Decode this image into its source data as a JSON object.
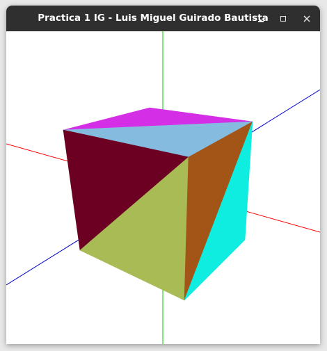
{
  "window": {
    "title": "Practica 1 IG - Luis Miguel Guirado Bautista",
    "controls": {
      "minimize_icon": "minimize-icon",
      "maximize_icon": "maximize-icon",
      "close_icon": "close-icon"
    }
  },
  "scene": {
    "background": "#ffffff",
    "axes": {
      "x_color": "#ff0000",
      "y_color": "#00cc00",
      "z_color": "#0000cc"
    },
    "cube_faces": {
      "top_a": "#d42ee6",
      "top_b": "#86bbe0",
      "left": "#6b0022",
      "front": "#a8bb55",
      "right_a": "#a35518",
      "right_b": "#0eede0"
    }
  }
}
